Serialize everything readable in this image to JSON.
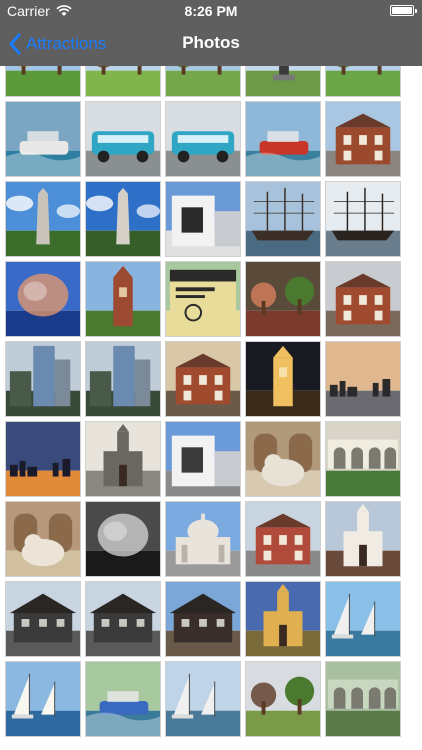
{
  "status": {
    "carrier": "Carrier",
    "time": "8:26 PM"
  },
  "nav": {
    "back_label": "Attractions",
    "title": "Photos",
    "accent": "#1a7cff",
    "bar_color": "#5f5f5f"
  },
  "photos": [
    {
      "desc": "park-garden",
      "sky": "#9fc6e8",
      "ground": "#5c9a3a",
      "accent": "#c9b48a",
      "shape": "trees"
    },
    {
      "desc": "park-lawn",
      "sky": "#b9d3e8",
      "ground": "#7fb54a",
      "accent": "#6b4a2a",
      "shape": "trees"
    },
    {
      "desc": "park-path",
      "sky": "#a8c8e0",
      "ground": "#74a84a",
      "accent": "#5a8a3a",
      "shape": "trees"
    },
    {
      "desc": "statue-park",
      "sky": "#c4d8ea",
      "ground": "#6c9a48",
      "accent": "#3a3a3a",
      "shape": "statue"
    },
    {
      "desc": "park-trees",
      "sky": "#b5d1ea",
      "ground": "#6aa646",
      "accent": "#4e7d34",
      "shape": "trees"
    },
    {
      "desc": "duck-boat-splash",
      "sky": "#7aa6c4",
      "ground": "#2e7fa0",
      "accent": "#e8e8e8",
      "shape": "boat"
    },
    {
      "desc": "duck-boat-street",
      "sky": "#d8dde2",
      "ground": "#8a8f92",
      "accent": "#2ea6c4",
      "shape": "bus"
    },
    {
      "desc": "duck-boat-street",
      "sky": "#d8dde2",
      "ground": "#8a8f92",
      "accent": "#2ea6c4",
      "shape": "bus"
    },
    {
      "desc": "red-duck-boat",
      "sky": "#8fb7d8",
      "ground": "#3a7f9e",
      "accent": "#c8362a",
      "shape": "boat"
    },
    {
      "desc": "faneuil-hall",
      "sky": "#a9c6e2",
      "ground": "#8a8580",
      "accent": "#9c4a2e",
      "shape": "building"
    },
    {
      "desc": "bunker-hill-monument",
      "sky": "#4c8fd8",
      "ground": "#3c6c2a",
      "accent": "#c8c4bc",
      "shape": "obelisk"
    },
    {
      "desc": "bunker-hill-monument",
      "sky": "#2e6fc8",
      "ground": "#365e28",
      "accent": "#d4d0c8",
      "shape": "obelisk"
    },
    {
      "desc": "modern-building",
      "sky": "#6a9ad6",
      "ground": "#e0e0e0",
      "accent": "#2a2a2a",
      "shape": "modern"
    },
    {
      "desc": "uss-constitution",
      "sky": "#a8c2dc",
      "ground": "#4a6a82",
      "accent": "#3a2e26",
      "shape": "ship"
    },
    {
      "desc": "uss-constitution",
      "sky": "#e6ebef",
      "ground": "#6a7d8c",
      "accent": "#2a2420",
      "shape": "ship"
    },
    {
      "desc": "jellyfish-aquarium",
      "sky": "#3a6ac8",
      "ground": "#1a3a8a",
      "accent": "#e89a6a",
      "shape": "blob"
    },
    {
      "desc": "brick-tower",
      "sky": "#8ab4e0",
      "ground": "#4a7a2e",
      "accent": "#9c4a32",
      "shape": "tower"
    },
    {
      "desc": "franklin-park-zoo-sign",
      "sky": "#a8c8a0",
      "ground": "#e8dc9a",
      "accent": "#2a2a2a",
      "shape": "sign"
    },
    {
      "desc": "garden-flowers",
      "sky": "#5a4a3a",
      "ground": "#7a3a2e",
      "accent": "#c87a5a",
      "shape": "trees"
    },
    {
      "desc": "old-state-house",
      "sky": "#c8ccd0",
      "ground": "#7a6a5e",
      "accent": "#a04a30",
      "shape": "building"
    },
    {
      "desc": "hancock-tower",
      "sky": "#c0ccd8",
      "ground": "#3a4a3a",
      "accent": "#6a8ab0",
      "shape": "skyscraper"
    },
    {
      "desc": "hancock-tower",
      "sky": "#c0ccd8",
      "ground": "#3a4a3a",
      "accent": "#6a8ab0",
      "shape": "skyscraper"
    },
    {
      "desc": "old-state-house-street",
      "sky": "#d8c8a8",
      "ground": "#6a5a4a",
      "accent": "#a04a2e",
      "shape": "building"
    },
    {
      "desc": "clock-tower-night",
      "sky": "#1a1a22",
      "ground": "#3a2a1a",
      "accent": "#f0c060",
      "shape": "tower"
    },
    {
      "desc": "charles-river-sunset",
      "sky": "#e0b890",
      "ground": "#6a6a70",
      "accent": "#2a2a2a",
      "shape": "skyline"
    },
    {
      "desc": "harbor-sunset",
      "sky": "#3a4a7a",
      "ground": "#e08a3a",
      "accent": "#1a1a2a",
      "shape": "skyline"
    },
    {
      "desc": "trinity-church",
      "sky": "#e8e4dc",
      "ground": "#8a8680",
      "accent": "#6a6662",
      "shape": "church"
    },
    {
      "desc": "copley-square-towers",
      "sky": "#6a9ad8",
      "ground": "#8a8a8a",
      "accent": "#3a3a3a",
      "shape": "modern"
    },
    {
      "desc": "library-lion",
      "sky": "#b09a7a",
      "ground": "#d8cab0",
      "accent": "#e8e2d6",
      "shape": "lion"
    },
    {
      "desc": "library-courtyard",
      "sky": "#d8d4c8",
      "ground": "#4a7a3a",
      "accent": "#f0ece0",
      "shape": "arcade"
    },
    {
      "desc": "library-lion",
      "sky": "#b8987a",
      "ground": "#d0c0a0",
      "accent": "#ece4d6",
      "shape": "lion"
    },
    {
      "desc": "dark-interior",
      "sky": "#4a4a4a",
      "ground": "#1a1a1a",
      "accent": "#d8d8d8",
      "shape": "blob"
    },
    {
      "desc": "christian-science-church",
      "sky": "#7aaae0",
      "ground": "#9a9a9a",
      "accent": "#e8e4dc",
      "shape": "dome"
    },
    {
      "desc": "red-brick-house",
      "sky": "#c8d4e0",
      "ground": "#8a8a8a",
      "accent": "#b04a3a",
      "shape": "building"
    },
    {
      "desc": "old-north-church",
      "sky": "#b8c8d8",
      "ground": "#6a4a3a",
      "accent": "#f0ece4",
      "shape": "church"
    },
    {
      "desc": "paul-revere-house",
      "sky": "#c8d4e0",
      "ground": "#5a5a5a",
      "accent": "#3a3a3a",
      "shape": "house"
    },
    {
      "desc": "paul-revere-house",
      "sky": "#c8d4e0",
      "ground": "#5a5a5a",
      "accent": "#3a3a3a",
      "shape": "house"
    },
    {
      "desc": "paul-revere-house-color",
      "sky": "#7aa6d8",
      "ground": "#6a5a4a",
      "accent": "#3a2e2a",
      "shape": "house"
    },
    {
      "desc": "kings-chapel-dusk",
      "sky": "#4a6ab0",
      "ground": "#7a6a3a",
      "accent": "#e0b050",
      "shape": "church"
    },
    {
      "desc": "sailboats-river",
      "sky": "#8ac0e8",
      "ground": "#3a7aa0",
      "accent": "#f0f0f0",
      "shape": "sail"
    },
    {
      "desc": "sailing-charles",
      "sky": "#8ab8e0",
      "ground": "#2e6aa0",
      "accent": "#f8f8f0",
      "shape": "sail"
    },
    {
      "desc": "swan-boats",
      "sky": "#a8c8a0",
      "ground": "#3a7a9a",
      "accent": "#3a6ac0",
      "shape": "boat"
    },
    {
      "desc": "marina-masts",
      "sky": "#c0d4e8",
      "ground": "#4a7a9a",
      "accent": "#f0f0f0",
      "shape": "sail"
    },
    {
      "desc": "park-glass-memorial",
      "sky": "#d8dce0",
      "ground": "#7a9a4a",
      "accent": "#6a4a3a",
      "shape": "trees"
    },
    {
      "desc": "glass-walkway",
      "sky": "#a8c0a0",
      "ground": "#5a7a4a",
      "accent": "#c8d8c0",
      "shape": "arcade"
    }
  ]
}
